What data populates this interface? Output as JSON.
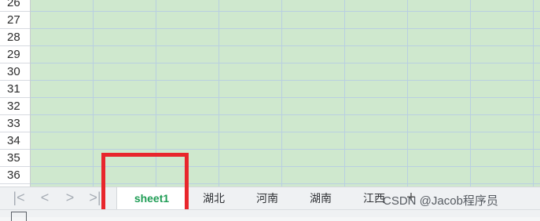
{
  "grid": {
    "row_numbers": [
      "26",
      "27",
      "28",
      "29",
      "30",
      "31",
      "32",
      "33",
      "34",
      "35",
      "36"
    ],
    "cell_color": "#cfe8ce"
  },
  "sheet_nav": {
    "first_icon": "skip-to-first-icon",
    "prev_icon": "chevron-left-icon",
    "next_icon": "chevron-right-icon",
    "last_icon": "skip-to-last-icon",
    "first_glyph": "|<",
    "prev_glyph": "<",
    "next_glyph": ">",
    "last_glyph": ">|"
  },
  "tabs": [
    {
      "label": "sheet1",
      "active": true
    },
    {
      "label": "湖北",
      "active": false
    },
    {
      "label": "河南",
      "active": false
    },
    {
      "label": "湖南",
      "active": false
    },
    {
      "label": "江西",
      "active": false
    }
  ],
  "add_sheet": {
    "glyph": "+",
    "icon": "plus-icon"
  },
  "watermark": "CSDN @Jacob程序员",
  "highlight": {
    "color": "#e8262c"
  },
  "accent_color": "#1f9d55"
}
